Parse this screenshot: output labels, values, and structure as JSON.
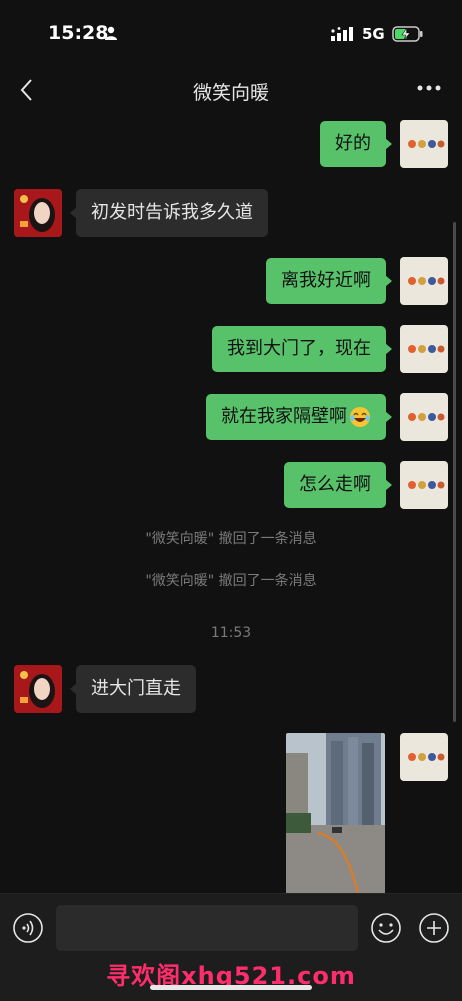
{
  "status": {
    "time": "15:28",
    "network": "5G"
  },
  "nav": {
    "title": "微笑向暖"
  },
  "messages": [
    {
      "text": "好的"
    },
    {
      "text": "初发时告诉我多久道"
    },
    {
      "text": "离我好近啊"
    },
    {
      "text": "我到大门了，现在"
    },
    {
      "text": "就在我家隔壁啊"
    },
    {
      "text": "怎么走啊"
    },
    {
      "text": "\"微笑向暖\" 撤回了一条消息"
    },
    {
      "text": "\"微笑向暖\" 撤回了一条消息"
    },
    {
      "text": "11:53"
    },
    {
      "text": "进大门直走"
    }
  ],
  "input": {
    "value": ""
  },
  "watermark": "寻欢阁xhg521.com",
  "colors": {
    "background": "#111111",
    "bubble_out": "#57c26a",
    "bubble_in": "#2c2c2c",
    "watermark": "#ff2d6b"
  },
  "icons": [
    "person-icon",
    "signal-icon",
    "battery-icon",
    "back-icon",
    "more-icon",
    "voice-icon",
    "emoji-icon",
    "plus-icon",
    "laugh-emoji-icon"
  ]
}
